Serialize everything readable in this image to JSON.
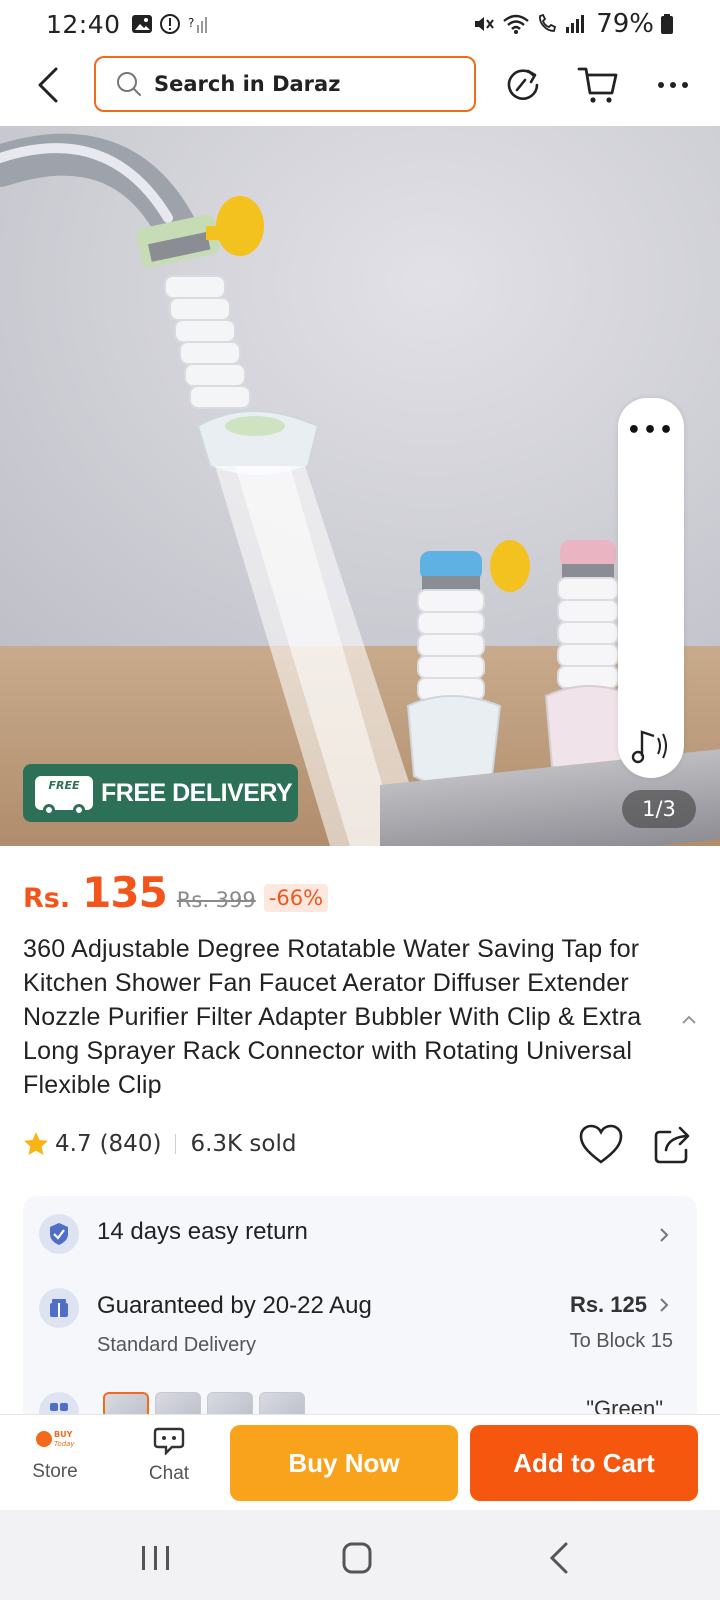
{
  "status_bar": {
    "time": "12:40",
    "battery": "79%"
  },
  "search": {
    "placeholder": "Search in Daraz"
  },
  "hero": {
    "badge": "FREE DELIVERY",
    "badge_tag": "FREE",
    "pager": "1/3",
    "more": "•••"
  },
  "price": {
    "currency": "Rs.",
    "amount": "135",
    "original": "Rs. 399",
    "discount": "-66%"
  },
  "product": {
    "title": "360 Adjustable Degree Rotatable Water Saving Tap for Kitchen Shower Fan Faucet Aerator Diffuser Extender Nozzle Purifier Filter Adapter Bubbler With Clip & Extra Long Sprayer Rack Connector with Rotating Universal Flexible Clip",
    "rating": "4.7",
    "reviews": "(840)",
    "sold": "6.3K sold"
  },
  "info": {
    "return": "14 days easy return",
    "delivery": "Guaranteed by 20-22 Aug",
    "delivery_type": "Standard Delivery",
    "delivery_price": "Rs. 125",
    "delivery_to": "To Block 15",
    "variant": "\"Green\""
  },
  "bottom": {
    "store": "Store",
    "chat": "Chat",
    "buy": "Buy Now",
    "cart": "Add to Cart",
    "store_logo": "BUY Today"
  },
  "colors": {
    "accent": "#f26a1b",
    "buy": "#f9a21c",
    "cart": "#f5570f",
    "free_badge": "#2d7058"
  }
}
